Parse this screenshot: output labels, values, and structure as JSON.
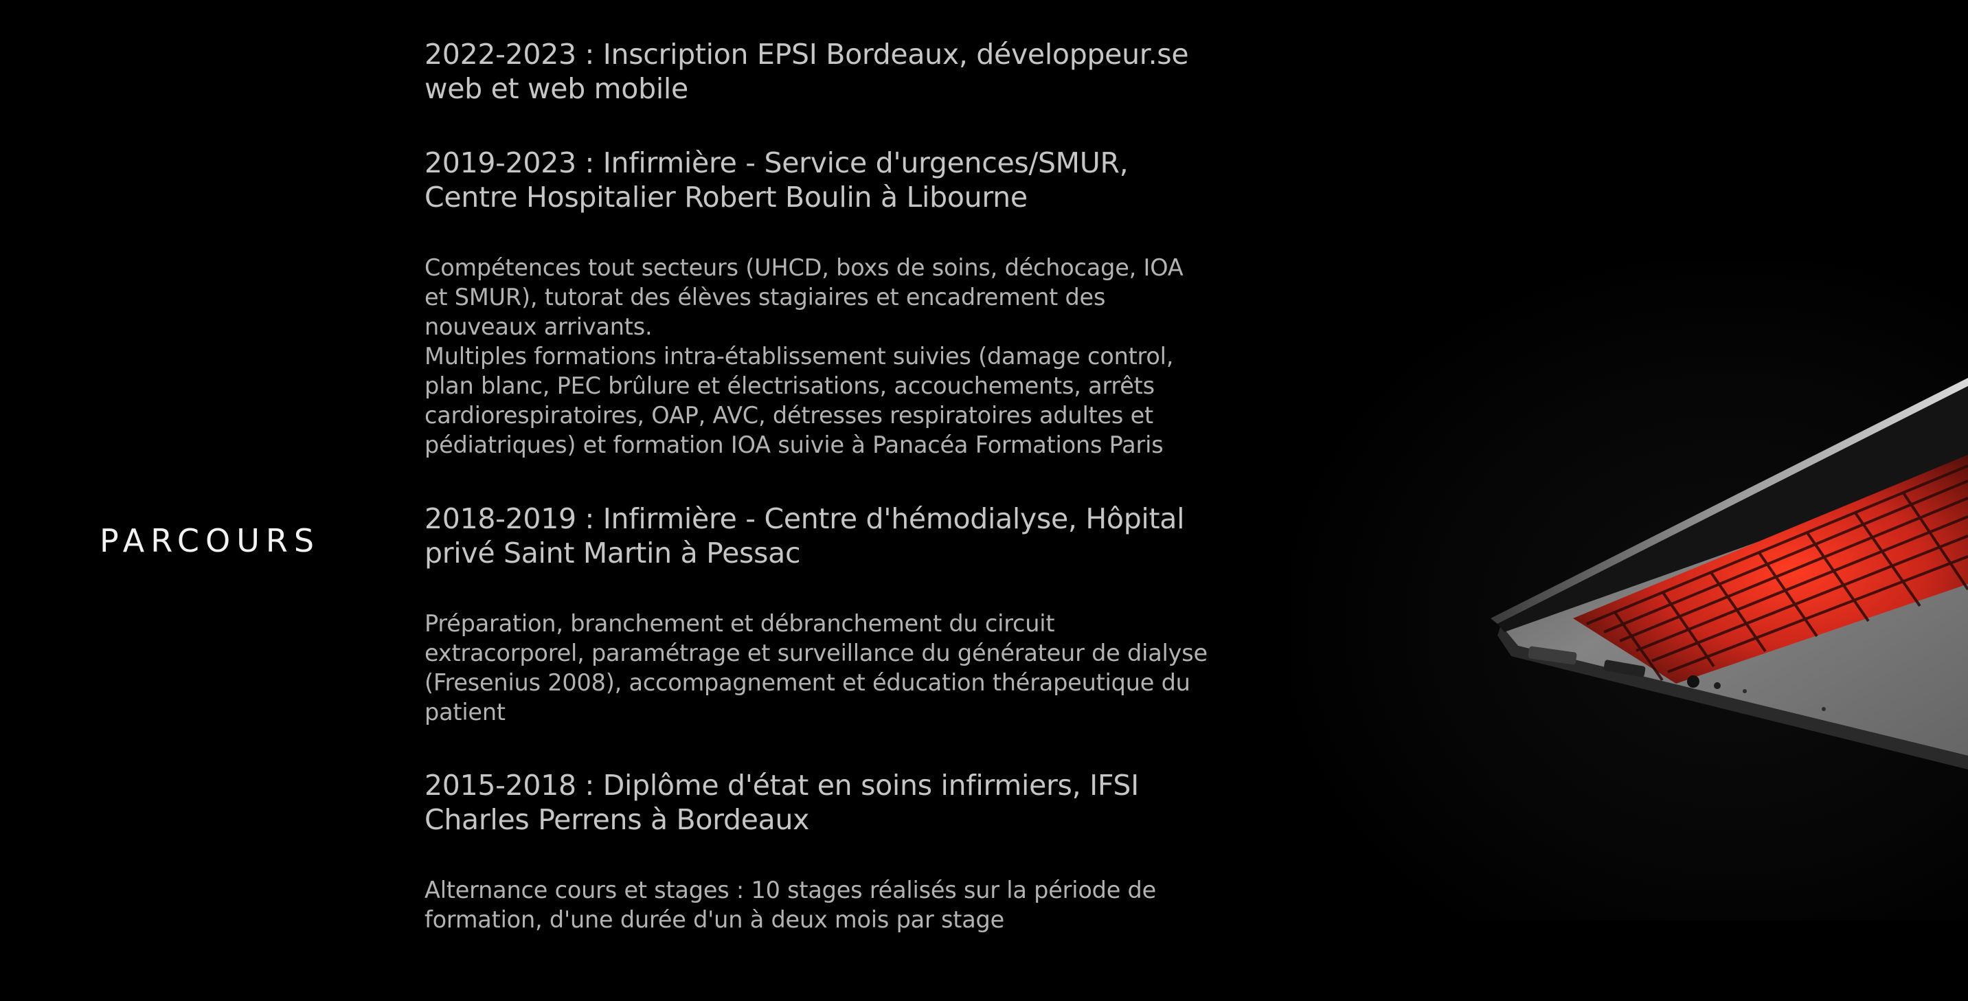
{
  "section": {
    "title": "PARCOURS"
  },
  "entries": [
    {
      "heading": "2022-2023 : Inscription EPSI Bordeaux, développeur.se web et web mobile",
      "description": []
    },
    {
      "heading": "2019-2023 : Infirmière - Service d'urgences/SMUR, Centre Hospitalier Robert Boulin à Libourne",
      "description": [
        "Compétences tout secteurs (UHCD, boxs de soins, déchocage, IOA et SMUR), tutorat des élèves stagiaires et encadrement des nouveaux arrivants.",
        "Multiples formations intra-établissement suivies (damage control, plan blanc, PEC brûlure et électrisations, accouchements, arrêts cardiorespiratoires, OAP, AVC, détresses respiratoires adultes et pédiatriques) et formation IOA suivie à Panacéa Formations Paris"
      ]
    },
    {
      "heading": "2018-2019 : Infirmière - Centre d'hémodialyse, Hôpital privé Saint Martin à Pessac",
      "description": [
        "Préparation, branchement et débranchement du circuit extracorporel, paramétrage et surveillance du générateur de dialyse (Fresenius 2008), accompagnement et éducation thérapeutique du patient"
      ]
    },
    {
      "heading": "2015-2018 : Diplôme d'état en soins infirmiers, IFSI Charles Perrens à Bordeaux",
      "description": [
        "Alternance cours et stages : 10 stages réalisés sur la période de formation, d'une durée d'un à deux mois par stage"
      ]
    }
  ],
  "image": {
    "name": "laptop-photo",
    "accent_color": "#e0301e"
  }
}
